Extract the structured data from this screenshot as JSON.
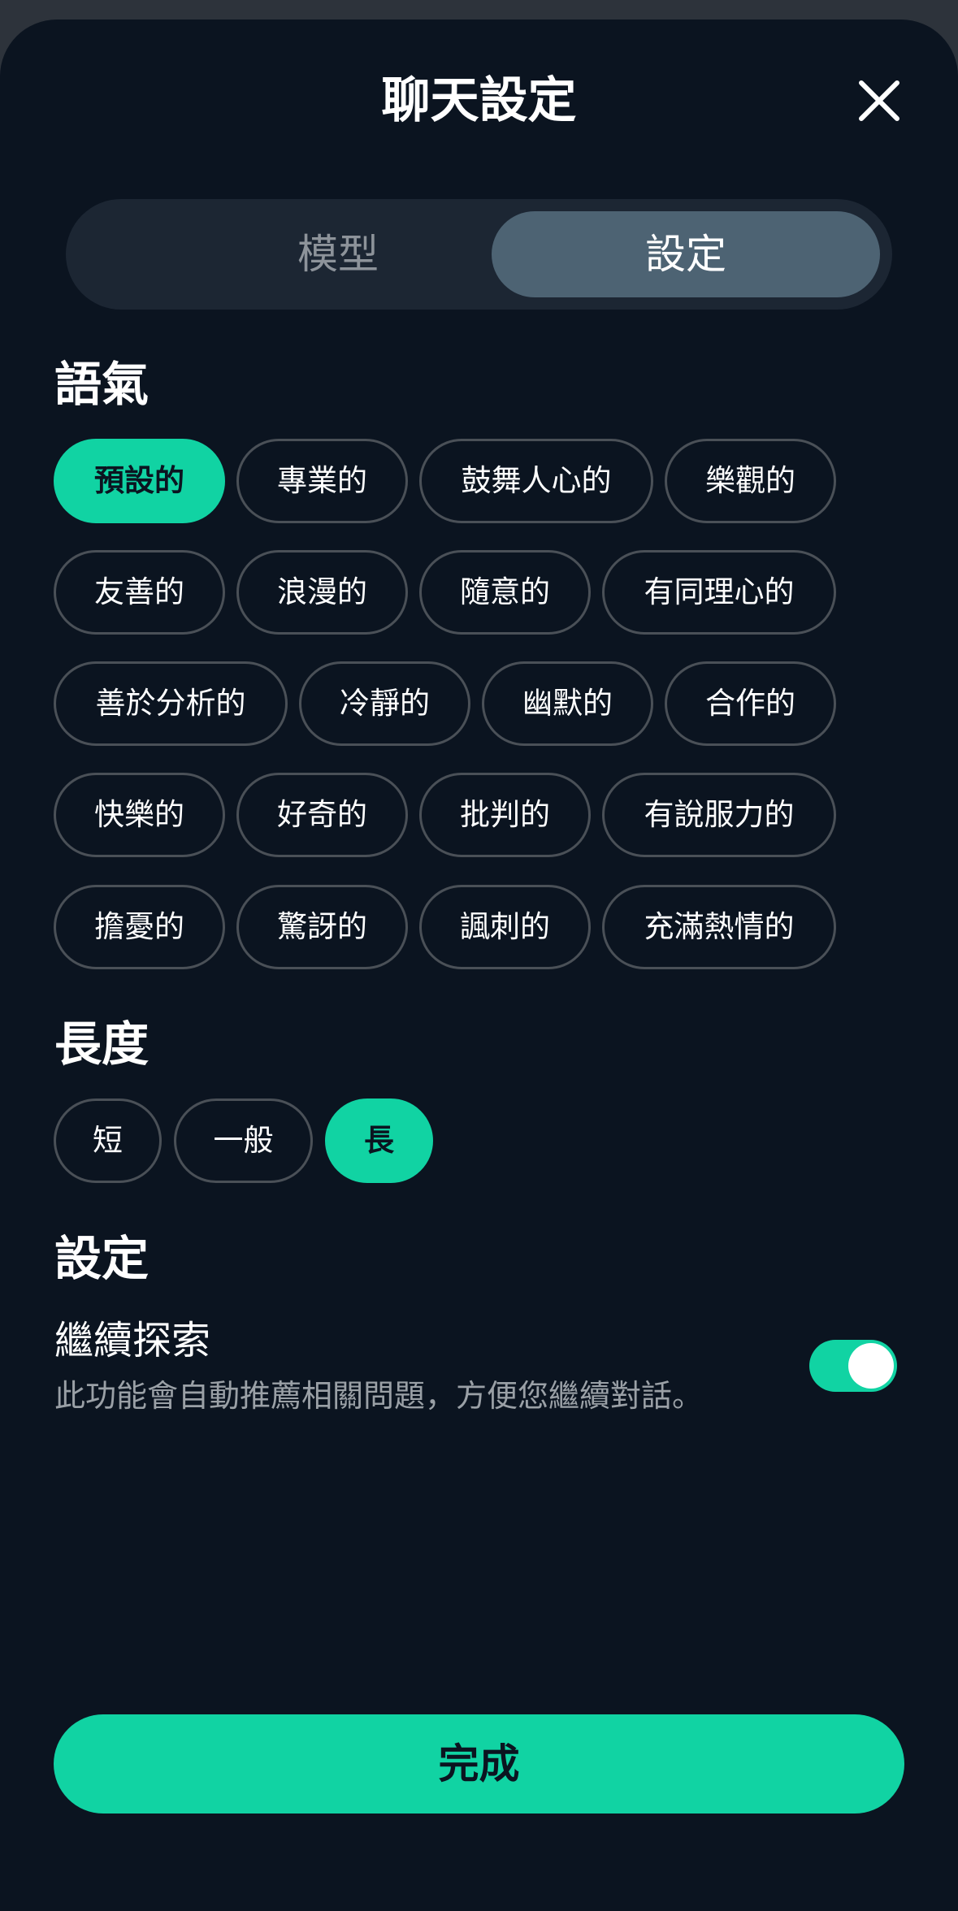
{
  "header": {
    "title": "聊天設定",
    "close_icon": "close-icon"
  },
  "segment": {
    "tabs": [
      {
        "label": "模型",
        "active": false
      },
      {
        "label": "設定",
        "active": true
      }
    ]
  },
  "tone": {
    "title": "語氣",
    "selected": "預設的",
    "options": [
      "預設的",
      "專業的",
      "鼓舞人心的",
      "樂觀的",
      "友善的",
      "浪漫的",
      "隨意的",
      "有同理心的",
      "善於分析的",
      "冷靜的",
      "幽默的",
      "合作的",
      "快樂的",
      "好奇的",
      "批判的",
      "有說服力的",
      "擔憂的",
      "驚訝的",
      "諷刺的",
      "充滿熱情的"
    ]
  },
  "length": {
    "title": "長度",
    "selected": "長",
    "options": [
      "短",
      "一般",
      "長"
    ]
  },
  "settings": {
    "title": "設定",
    "explore": {
      "title": "繼續探索",
      "description": "此功能會自動推薦相關問題，方便您繼續對話。",
      "enabled": true
    }
  },
  "footer": {
    "done_label": "完成"
  },
  "colors": {
    "accent": "#11d3a3",
    "background": "#0b1420",
    "segment_active": "#4d6373"
  }
}
